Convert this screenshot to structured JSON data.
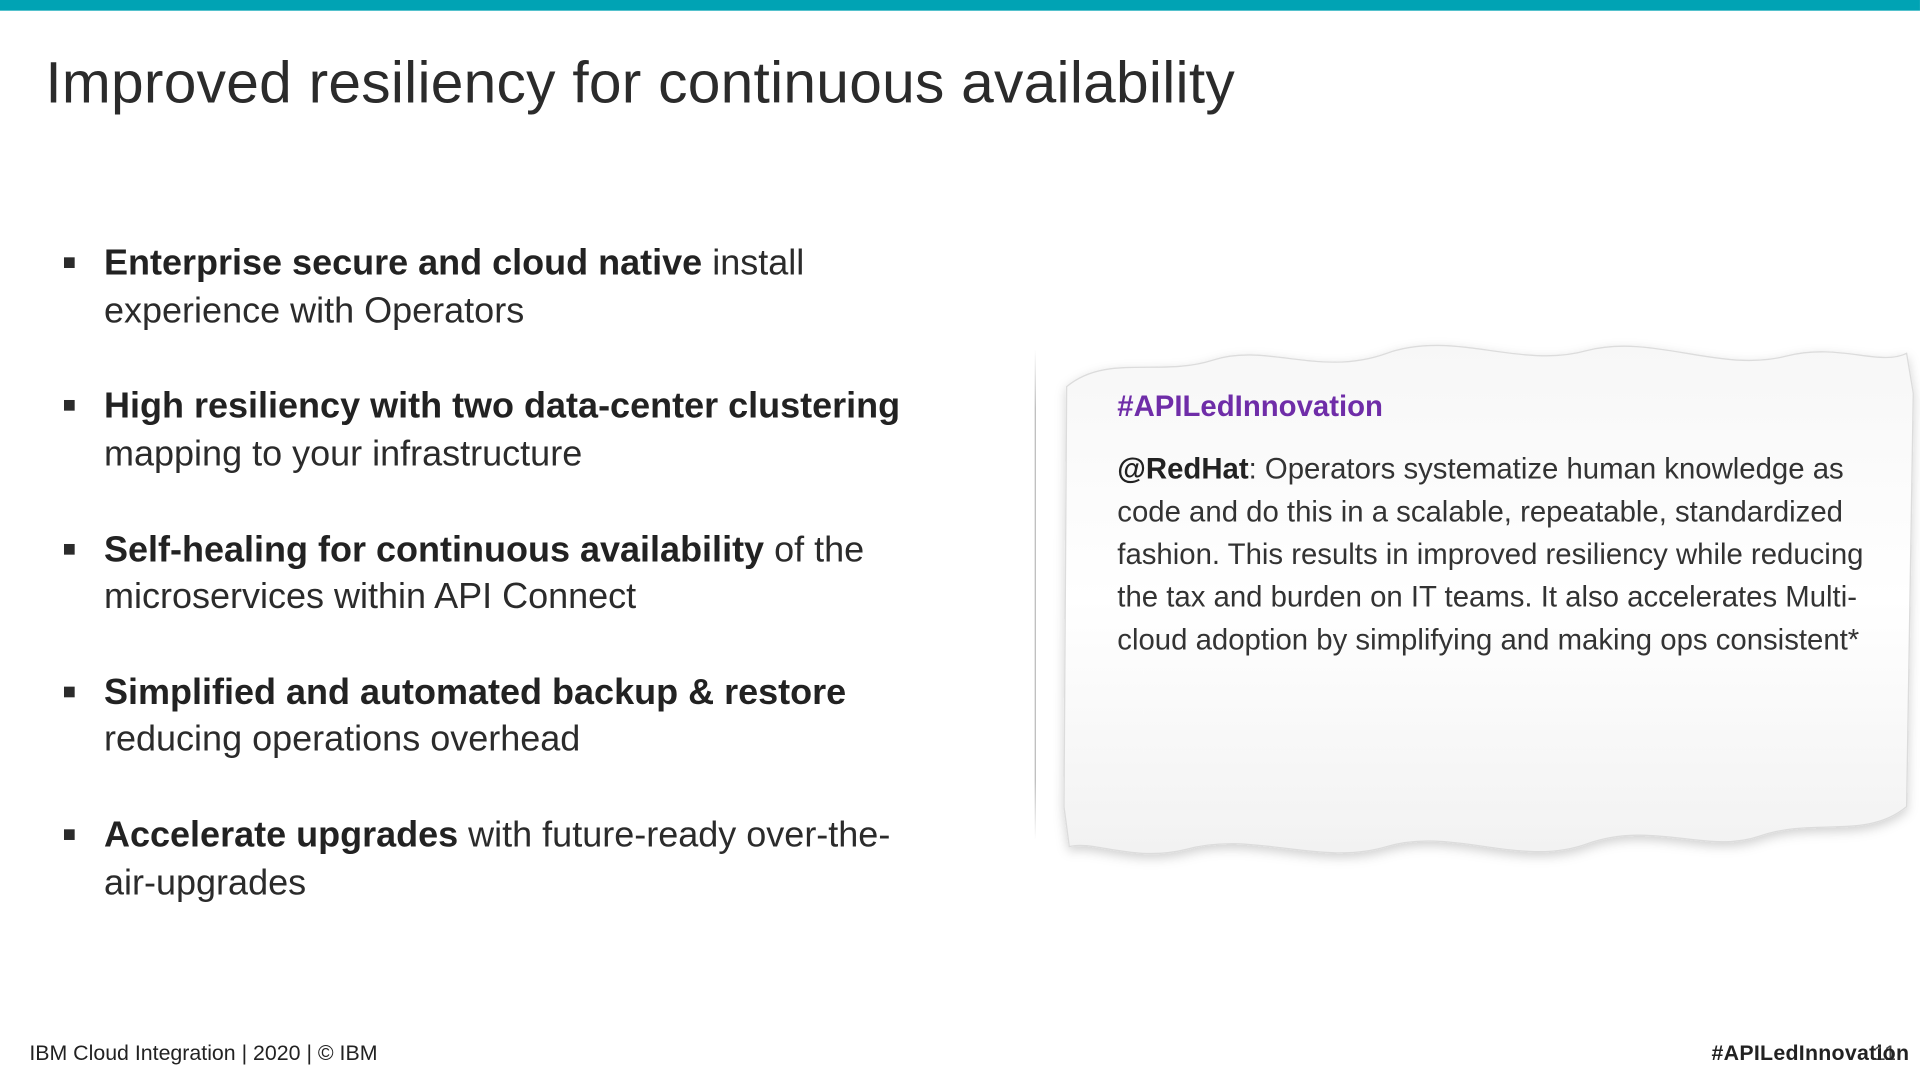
{
  "title": "Improved resiliency for continuous availability",
  "bullets": [
    {
      "bold": "Enterprise secure and cloud native",
      "rest": " install experience with Operators"
    },
    {
      "bold": "High resiliency with two data-center clustering",
      "rest": " mapping to your infrastructure"
    },
    {
      "bold": "Self-healing for continuous availability",
      "rest": " of the microservices within API Connect"
    },
    {
      "bold": "Simplified and automated backup & restore",
      "rest": " reducing operations overhead"
    },
    {
      "bold": "Accelerate upgrades",
      "rest": " with future-ready over-the-air-upgrades"
    }
  ],
  "callout": {
    "hashtag": "#APILedInnovation",
    "handle": "@RedHat",
    "text": ": Operators systematize human knowledge as code and do this in a scalable, repeatable, standardized fashion. This results in improved resiliency while reducing the tax and burden on IT teams. It also accelerates Multi-cloud adoption by simplifying and making ops consistent*"
  },
  "footer": {
    "left": "IBM Cloud Integration  | 2020 | © IBM",
    "right": "#APILedInnovation",
    "page": "11"
  },
  "colors": {
    "topbar": "#00a3b4",
    "hashtag": "#6f2da8"
  }
}
